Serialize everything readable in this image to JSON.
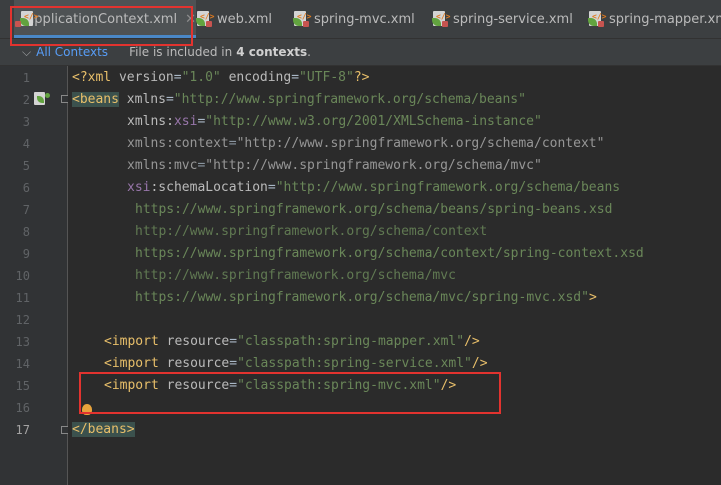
{
  "tabs": [
    {
      "label": "applicationContext.xml",
      "active": true,
      "closable": true
    },
    {
      "label": "web.xml",
      "active": false,
      "closable": false
    },
    {
      "label": "spring-mvc.xml",
      "active": false,
      "closable": false
    },
    {
      "label": "spring-service.xml",
      "active": false,
      "closable": false
    },
    {
      "label": "spring-mapper.xml",
      "active": false,
      "closable": false
    }
  ],
  "infobar": {
    "contexts_label": "All Contexts",
    "message_prefix": "File is included in",
    "message_count": "4 contexts",
    "message_suffix": "."
  },
  "close_glyph": "✕",
  "line_numbers": [
    "1",
    "2",
    "3",
    "4",
    "5",
    "6",
    "7",
    "8",
    "9",
    "10",
    "11",
    "12",
    "13",
    "14",
    "15",
    "16",
    "17"
  ],
  "code": {
    "l1": {
      "a": "<?xml ",
      "b": "version",
      "c": "=",
      "d": "\"1.0\"",
      "e": " ",
      "f": "encoding",
      "g": "=",
      "h": "\"UTF-8\"",
      "i": "?>"
    },
    "l2": {
      "tag": "<beans",
      "attr": " xmlns",
      "eq": "=",
      "val": "\"http://www.springframework.org/schema/beans\""
    },
    "l3": {
      "ns": "xmlns",
      "colon": ":",
      "nsname": "xsi",
      "eq": "=",
      "val": "\"http://www.w3.org/2001/XMLSchema-instance\""
    },
    "l4": {
      "attr": "xmlns:context",
      "eq": "=",
      "val": "\"http://www.springframework.org/schema/context\""
    },
    "l5": {
      "attr": "xmlns:mvc",
      "eq": "=",
      "val": "\"http://www.springframework.org/schema/mvc\""
    },
    "l6": {
      "ns": "xsi",
      "attr": ":schemaLocation",
      "eq": "=",
      "val": "\"http://www.springframework.org/schema/beans"
    },
    "l7": "https://www.springframework.org/schema/beans/spring-beans.xsd",
    "l8": "http://www.springframework.org/schema/context",
    "l9": "https://www.springframework.org/schema/context/spring-context.xsd",
    "l10": "http://www.springframework.org/schema/mvc",
    "l11": {
      "val": "https://www.springframework.org/schema/mvc/spring-mvc.xsd\"",
      "close": ">"
    },
    "l13": {
      "tag": "<import",
      "attr": " resource",
      "eq": "=",
      "val": "\"classpath:spring-mapper.xml\"",
      "close": "/>"
    },
    "l14": {
      "tag": "<import",
      "attr": " resource",
      "eq": "=",
      "val": "\"classpath:spring-service.xml\"",
      "close": "/>"
    },
    "l15": {
      "tag": "<import",
      "attr": " resource",
      "eq": "=",
      "val": "\"classpath:spring-mvc.xml\"",
      "close": "/>"
    },
    "l17": {
      "tag": "</beans",
      "close": ">"
    }
  },
  "colors": {
    "annotation_red": "#e2332f",
    "tab_underline": "#4a88c7",
    "xml_tag": "#e8bf6a",
    "xml_string": "#6a8759",
    "xml_namespace": "#9876aa"
  }
}
